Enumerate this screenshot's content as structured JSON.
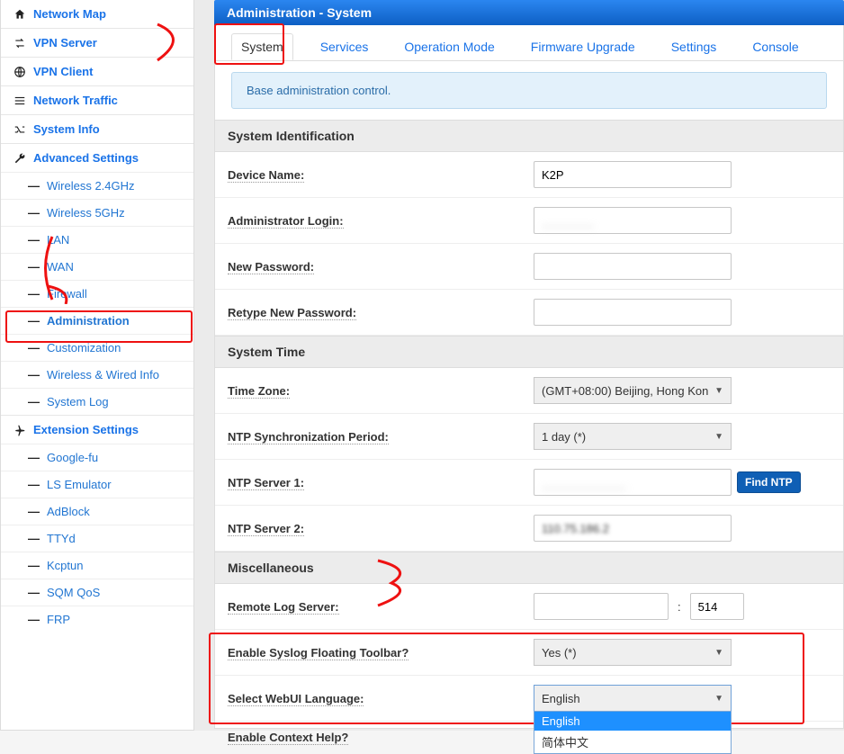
{
  "sidebar": {
    "items": [
      {
        "label": "Network Map"
      },
      {
        "label": "VPN Server"
      },
      {
        "label": "VPN Client"
      },
      {
        "label": "Network Traffic"
      },
      {
        "label": "System Info"
      },
      {
        "label": "Advanced Settings"
      },
      {
        "label": "Extension Settings"
      }
    ],
    "advanced_sub": [
      "Wireless 2.4GHz",
      "Wireless 5GHz",
      "LAN",
      "WAN",
      "Firewall",
      "Administration",
      "Customization",
      "Wireless & Wired Info",
      "System Log"
    ],
    "ext_sub": [
      "Google-fu",
      "LS Emulator",
      "AdBlock",
      "TTYd",
      "Kcptun",
      "SQM QoS",
      "FRP"
    ]
  },
  "page_title": "Administration - System",
  "tabs": [
    "System",
    "Services",
    "Operation Mode",
    "Firmware Upgrade",
    "Settings",
    "Console"
  ],
  "infobox": "Base administration control.",
  "sections": {
    "sys_id": {
      "heading": "System Identification",
      "device_name_label": "Device Name:",
      "device_name_value": "K2P",
      "admin_login_label": "Administrator Login:",
      "admin_login_value": "",
      "new_pw_label": "New Password:",
      "retype_pw_label": "Retype New Password:"
    },
    "sys_time": {
      "heading": "System Time",
      "tz_label": "Time Zone:",
      "tz_value": "(GMT+08:00) Beijing, Hong Kon",
      "ntp_period_label": "NTP Synchronization Period:",
      "ntp_period_value": "1 day (*)",
      "ntp1_label": "NTP Server 1:",
      "ntp1_value": "",
      "ntp2_label": "NTP Server 2:",
      "ntp2_value": "110.75.186.2",
      "find_ntp": "Find NTP"
    },
    "misc": {
      "heading": "Miscellaneous",
      "remote_log_label": "Remote Log Server:",
      "remote_log_port": "514",
      "syslog_label": "Enable Syslog Floating Toolbar?",
      "syslog_value": "Yes (*)",
      "lang_label": "Select WebUI Language:",
      "lang_value": "English",
      "lang_options": [
        "English",
        "简体中文"
      ],
      "ctx_help_label": "Enable Context Help?"
    }
  }
}
